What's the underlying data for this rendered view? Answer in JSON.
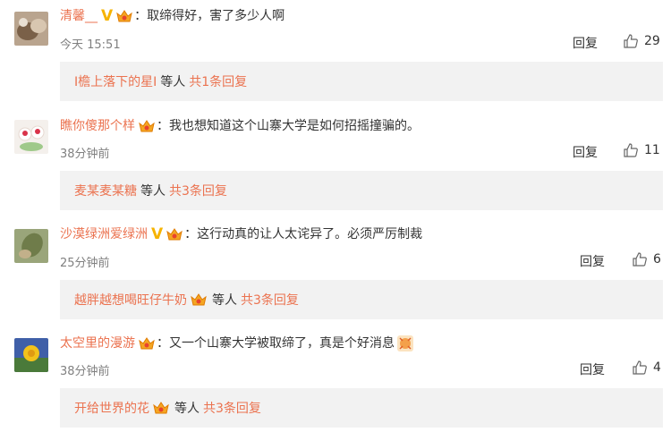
{
  "comments": [
    {
      "user": "清馨__",
      "verified_mark": "V",
      "text": "取缔得好，害了多少人啊",
      "time": "今天 15:51",
      "reply_label": "回复",
      "likes": "29",
      "sub": {
        "user": "I檐上落下的星I",
        "etc": "等人",
        "more": "共1条回复",
        "has_badge": false
      }
    },
    {
      "user": "瞧你傻那个样",
      "text": "我也想知道这个山寨大学是如何招摇撞骗的。",
      "time": "38分钟前",
      "reply_label": "回复",
      "likes": "11",
      "sub": {
        "user": "麦某麦某糖",
        "etc": "等人",
        "more": "共3条回复",
        "has_badge": false
      }
    },
    {
      "user": "沙漠绿洲爱绿洲",
      "verified_mark": "V",
      "text": "这行动真的让人太诧异了。必须严厉制裁",
      "time": "25分钟前",
      "reply_label": "回复",
      "likes": "6",
      "sub": {
        "user": "越胖越想喝旺仔牛奶",
        "etc": "等人",
        "more": "共3条回复",
        "has_badge": true
      }
    },
    {
      "user": "太空里的漫游",
      "text": "又一个山寨大学被取缔了，真是个好消息",
      "time": "38分钟前",
      "reply_label": "回复",
      "likes": "4",
      "sub": {
        "user": "开给世界的花",
        "etc": "等人",
        "more": "共3条回复",
        "has_badge": true
      }
    }
  ],
  "colors": {
    "username": "#eb7350",
    "verified": "#f6b300",
    "time": "#808080",
    "subbox_bg": "#f2f2f2"
  },
  "icons": [
    "vip-crown-icon",
    "thumbs-up-icon",
    "celebration-emoji-icon"
  ]
}
